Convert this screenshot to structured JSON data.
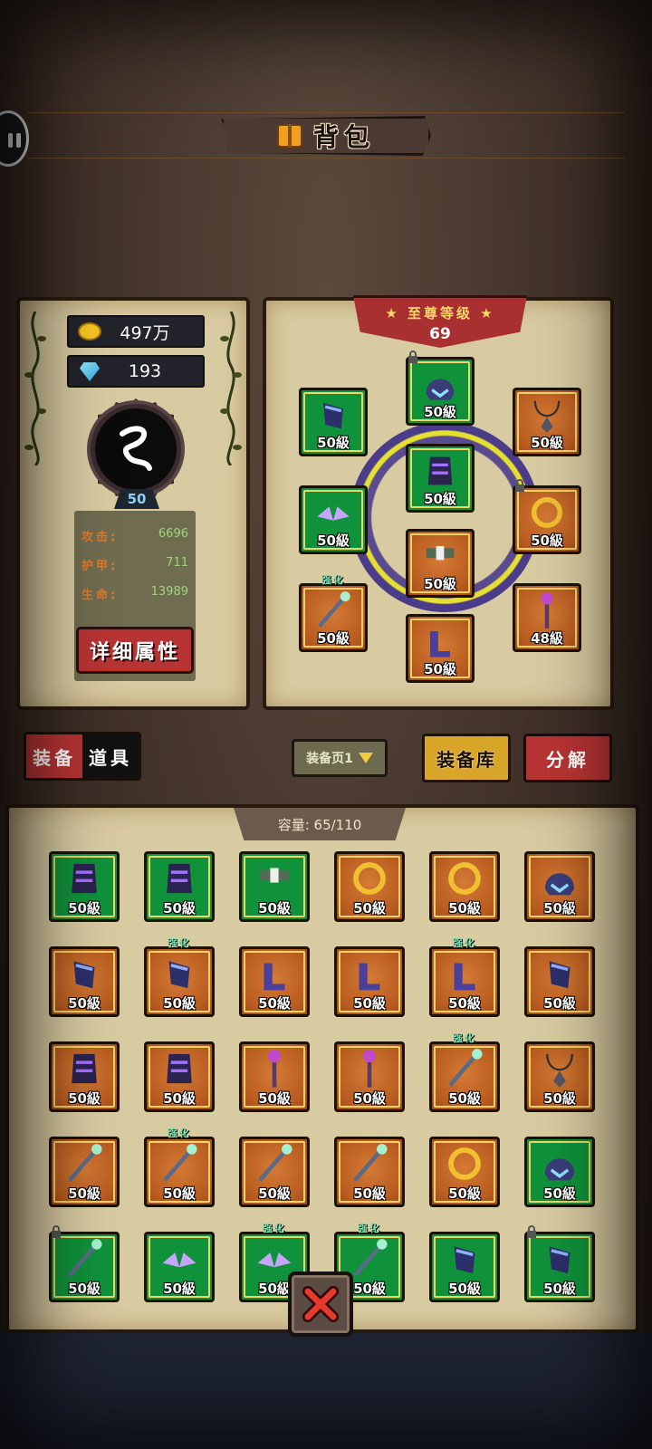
{
  "header": {
    "title": "背包"
  },
  "player": {
    "gold": "497万",
    "diamonds": "193",
    "level": "50",
    "stats": [
      {
        "label": "攻击:",
        "value": "6696"
      },
      {
        "label": "护甲:",
        "value": "711"
      },
      {
        "label": "生命:",
        "value": "13989"
      }
    ],
    "detail_button": "详细属性"
  },
  "rank": {
    "title": "至尊等级",
    "level": "69"
  },
  "equipped": [
    {
      "name": "helmet",
      "level": "50級",
      "bg": "green",
      "locked": true
    },
    {
      "name": "bracer",
      "level": "50級",
      "bg": "green"
    },
    {
      "name": "necklace",
      "level": "50級",
      "bg": "orange"
    },
    {
      "name": "armor",
      "level": "50級",
      "bg": "green"
    },
    {
      "name": "wings",
      "level": "50級",
      "bg": "green"
    },
    {
      "name": "ring",
      "level": "50級",
      "bg": "orange",
      "locked": true
    },
    {
      "name": "belt",
      "level": "50級",
      "bg": "orange"
    },
    {
      "name": "staff",
      "level": "50級",
      "bg": "orange",
      "enhanced": "强化"
    },
    {
      "name": "scepter",
      "level": "48級",
      "bg": "orange"
    },
    {
      "name": "boots",
      "level": "50級",
      "bg": "orange"
    }
  ],
  "tabs": {
    "equipment": "装备",
    "items": "道具"
  },
  "page_selector": "装备页1",
  "buttons": {
    "warehouse": "装备库",
    "dismantle": "分解"
  },
  "inventory": {
    "capacity": "容量: 65/110",
    "items": [
      {
        "icon": "armor-icon",
        "level": "50級",
        "bg": "green"
      },
      {
        "icon": "armor-icon",
        "level": "50級",
        "bg": "green"
      },
      {
        "icon": "belt-icon",
        "level": "50級",
        "bg": "green"
      },
      {
        "icon": "crown-icon",
        "level": "50級",
        "bg": "orange"
      },
      {
        "icon": "crown-icon",
        "level": "50級",
        "bg": "orange"
      },
      {
        "icon": "helmet-icon",
        "level": "50級",
        "bg": "orange"
      },
      {
        "icon": "gauntlet-icon",
        "level": "50級",
        "bg": "orange"
      },
      {
        "icon": "gauntlet-icon",
        "level": "50級",
        "bg": "orange",
        "enhanced": "强化"
      },
      {
        "icon": "boots-icon",
        "level": "50級",
        "bg": "orange"
      },
      {
        "icon": "boots-icon",
        "level": "50級",
        "bg": "orange"
      },
      {
        "icon": "boots-icon",
        "level": "50級",
        "bg": "orange",
        "enhanced": "强化"
      },
      {
        "icon": "bracer-icon",
        "level": "50級",
        "bg": "orange"
      },
      {
        "icon": "pauldron-icon",
        "level": "50級",
        "bg": "orange"
      },
      {
        "icon": "pauldron-icon",
        "level": "50級",
        "bg": "orange"
      },
      {
        "icon": "staff-icon",
        "level": "50級",
        "bg": "orange"
      },
      {
        "icon": "staff-icon",
        "level": "50級",
        "bg": "orange"
      },
      {
        "icon": "spear-icon",
        "level": "50級",
        "bg": "orange",
        "enhanced": "强化"
      },
      {
        "icon": "claw-icon",
        "level": "50級",
        "bg": "orange"
      },
      {
        "icon": "sword-icon",
        "level": "50級",
        "bg": "orange"
      },
      {
        "icon": "sword-icon",
        "level": "50級",
        "bg": "orange",
        "enhanced": "强化"
      },
      {
        "icon": "dagger-icon",
        "level": "50級",
        "bg": "orange"
      },
      {
        "icon": "dagger-icon",
        "level": "50級",
        "bg": "orange"
      },
      {
        "icon": "ring-icon",
        "level": "50級",
        "bg": "orange"
      },
      {
        "icon": "flower-helmet-icon",
        "level": "50級",
        "bg": "green"
      },
      {
        "icon": "wand-icon",
        "level": "50級",
        "bg": "green",
        "locked": true
      },
      {
        "icon": "winged-helmet-icon",
        "level": "50級",
        "bg": "green"
      },
      {
        "icon": "winged-helmet-icon",
        "level": "50級",
        "bg": "green",
        "enhanced": "强化"
      },
      {
        "icon": "axe-icon",
        "level": "50級",
        "bg": "green",
        "enhanced": "强化"
      },
      {
        "icon": "bracer-icon",
        "level": "50級",
        "bg": "green"
      },
      {
        "icon": "bracer-icon",
        "level": "50級",
        "bg": "green",
        "locked": true
      }
    ]
  },
  "colors": {
    "slot_green": "#10923a",
    "slot_orange": "#b95c20",
    "accent_red": "#b83434",
    "accent_gold": "#d8a529",
    "panel_parchment": "#d9cba1"
  }
}
